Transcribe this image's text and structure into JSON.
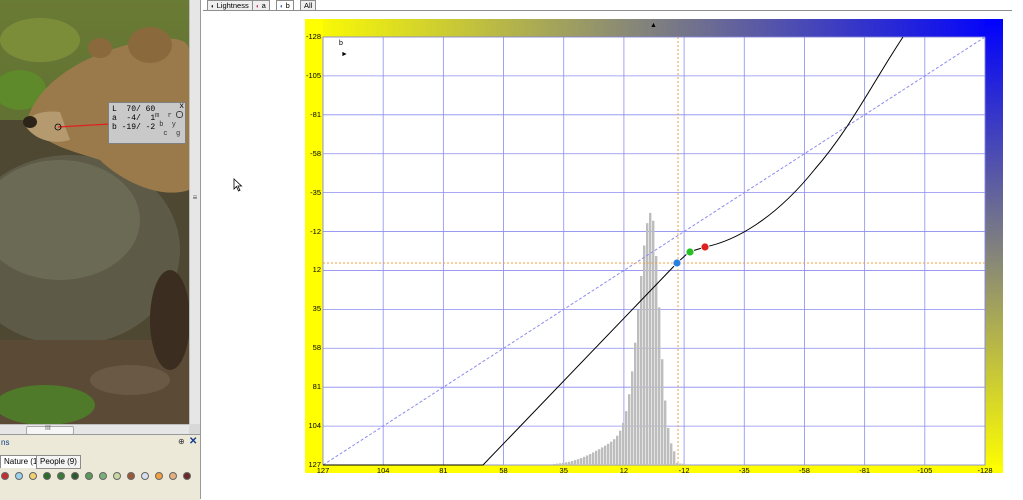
{
  "panel": {
    "title": "ns",
    "pin_glyph": "⊕",
    "close_glyph": "✕",
    "tabs": [
      {
        "label": "Nature (15)"
      },
      {
        "label": "People (9)"
      }
    ]
  },
  "readout": {
    "row_l": "L  70/ 60",
    "row_a": "a  -4/  1",
    "row_b": "b -19/ -2",
    "fx": "m  r\n b  y\n  c  g",
    "close": "x"
  },
  "hscroll_grip": "III",
  "vscroll_grip": "≡",
  "tabs": [
    {
      "label": "Lightness"
    },
    {
      "label": "a"
    },
    {
      "label": "b"
    },
    {
      "label": "All"
    }
  ],
  "graph": {
    "channel": "b",
    "y_labels": [
      "-128",
      "-105",
      "-81",
      "-58",
      "-35",
      "-12",
      "12",
      "35",
      "58",
      "81",
      "104",
      "127"
    ],
    "x_labels": [
      "127",
      "104",
      "81",
      "58",
      "35",
      "12",
      "-12",
      "-35",
      "-58",
      "-81",
      "-105",
      "-128"
    ],
    "play_glyph": "►",
    "top_glyph": "▲"
  },
  "colors": {
    "grid": "#8c8cf0",
    "yellow": "#ffff00",
    "blue": "#0000ff",
    "histogram": "#bdbdbd",
    "curve": "#000000",
    "guide": "#f0a040",
    "point_blue": "#2a7fe0",
    "point_green": "#26c026",
    "point_red": "#e02020"
  }
}
